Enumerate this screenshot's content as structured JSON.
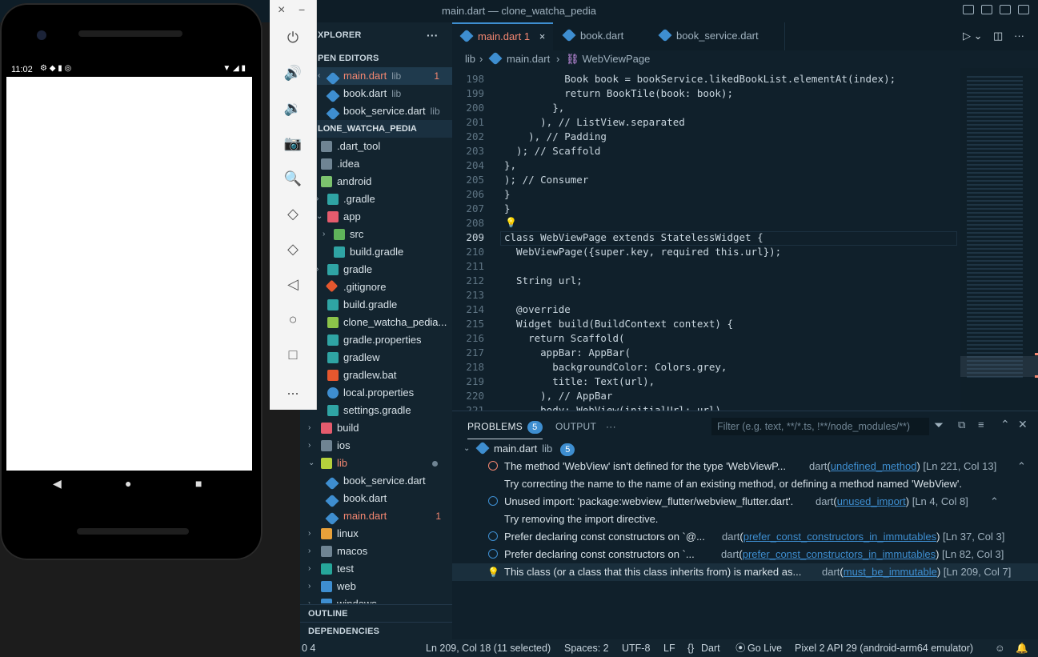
{
  "window": {
    "title": "main.dart — clone_watcha_pedia"
  },
  "emulator": {
    "close": "×",
    "minimize": "−",
    "status_time": "11:02",
    "tools": [
      "power-icon",
      "volume-up-icon",
      "volume-down-icon",
      "camera-icon",
      "zoom-icon",
      "rotate-left-icon",
      "rotate-right-icon",
      "back-icon",
      "home-icon",
      "overview-icon",
      "more-icon"
    ],
    "more_label": "..."
  },
  "explorer": {
    "title": "XPLORER",
    "more": "···",
    "open_editors": "PEN EDITORS",
    "open_files": [
      {
        "name": "main.dart",
        "sub": "lib",
        "count": "1",
        "error": true,
        "selected": true
      },
      {
        "name": "book.dart",
        "sub": "lib"
      },
      {
        "name": "book_service.dart",
        "sub": "lib"
      }
    ],
    "project": "LONE_WATCHA_PEDIA",
    "tree": [
      {
        "name": ".dart_tool"
      },
      {
        "name": ".idea"
      },
      {
        "name": "android"
      },
      {
        "name": ".gradle"
      },
      {
        "name": "app"
      },
      {
        "name": "src"
      },
      {
        "name": "build.gradle"
      },
      {
        "name": "gradle"
      },
      {
        "name": ".gitignore"
      },
      {
        "name": "build.gradle"
      },
      {
        "name": "clone_watcha_pedia..."
      },
      {
        "name": "gradle.properties"
      },
      {
        "name": "gradlew"
      },
      {
        "name": "gradlew.bat"
      },
      {
        "name": "local.properties"
      },
      {
        "name": "settings.gradle"
      },
      {
        "name": "build"
      },
      {
        "name": "ios"
      },
      {
        "name": "lib"
      },
      {
        "name": "book_service.dart"
      },
      {
        "name": "book.dart"
      },
      {
        "name": "main.dart",
        "count": "1"
      },
      {
        "name": "linux"
      },
      {
        "name": "macos"
      },
      {
        "name": "test"
      },
      {
        "name": "web"
      },
      {
        "name": "windows"
      }
    ],
    "outline": "OUTLINE",
    "dependencies": "DEPENDENCIES"
  },
  "tabs": [
    {
      "label": "main.dart",
      "count": "1",
      "close": "×"
    },
    {
      "label": "book.dart"
    },
    {
      "label": "book_service.dart"
    }
  ],
  "breadcrumb": {
    "folder": "lib",
    "file": "main.dart",
    "symbol": "WebViewPage"
  },
  "editor": {
    "lines": [
      {
        "n": "198",
        "code": "          Book book = bookService.likedBookList.elementAt(index);"
      },
      {
        "n": "199",
        "code": "          return BookTile(book: book);"
      },
      {
        "n": "200",
        "code": "        },"
      },
      {
        "n": "201",
        "code": "      ), // ListView.separated"
      },
      {
        "n": "202",
        "code": "    ), // Padding"
      },
      {
        "n": "203",
        "code": "  ); // Scaffold"
      },
      {
        "n": "204",
        "code": "},"
      },
      {
        "n": "205",
        "code": "); // Consumer"
      },
      {
        "n": "206",
        "code": "}"
      },
      {
        "n": "207",
        "code": "}"
      },
      {
        "n": "208",
        "code": ""
      },
      {
        "n": "209",
        "code": "class WebViewPage extends StatelessWidget {"
      },
      {
        "n": "210",
        "code": "  WebViewPage({super.key, required this.url});"
      },
      {
        "n": "211",
        "code": ""
      },
      {
        "n": "212",
        "code": "  String url;"
      },
      {
        "n": "213",
        "code": ""
      },
      {
        "n": "214",
        "code": "  @override"
      },
      {
        "n": "215",
        "code": "  Widget build(BuildContext context) {"
      },
      {
        "n": "216",
        "code": "    return Scaffold("
      },
      {
        "n": "217",
        "code": "      appBar: AppBar("
      },
      {
        "n": "218",
        "code": "        backgroundColor: Colors.grey,"
      },
      {
        "n": "219",
        "code": "        title: Text(url),"
      },
      {
        "n": "220",
        "code": "      ), // AppBar"
      },
      {
        "n": "221",
        "code": "      body: WebView(initialUrl: url)"
      }
    ]
  },
  "panel": {
    "tabs": {
      "problems": "PROBLEMS",
      "problems_count": "5",
      "output": "OUTPUT",
      "more": "···"
    },
    "filter_placeholder": "Filter (e.g. text, **/*.ts, !**/node_modules/**)",
    "file": {
      "name": "main.dart",
      "sub": "lib",
      "count": "5"
    },
    "problems": [
      {
        "severity": "error",
        "msg": "The method 'WebView' isn't defined for the type 'WebViewP...",
        "src": "dart",
        "code": "undefined_method",
        "pos": "[Ln 221, Col 13]",
        "hint": "Try correcting the name to the name of an existing method, or defining a method named 'WebView'."
      },
      {
        "severity": "info",
        "msg": "Unused import: 'package:webview_flutter/webview_flutter.dart'.",
        "src": "dart",
        "code": "unused_import",
        "pos": "[Ln 4, Col 8]",
        "hint": "Try removing the import directive."
      },
      {
        "severity": "info",
        "msg": "Prefer declaring const constructors on `@...",
        "src": "dart",
        "code": "prefer_const_constructors_in_immutables",
        "pos": "[Ln 37, Col 3]"
      },
      {
        "severity": "info",
        "msg": "Prefer declaring const constructors on `...",
        "src": "dart",
        "code": "prefer_const_constructors_in_immutables",
        "pos": "[Ln 82, Col 3]"
      },
      {
        "severity": "hint",
        "msg": "This class (or a class that this class inherits from) is marked as...",
        "src": "dart",
        "code": "must_be_immutable",
        "pos": "[Ln 209, Col 7]"
      }
    ]
  },
  "statusbar": {
    "problems": "0  4",
    "position": "Ln 209, Col 18 (11 selected)",
    "spaces": "Spaces: 2",
    "encoding": "UTF-8",
    "eol": "LF",
    "language": "Dart",
    "braces": "{}",
    "golive": "Go Live",
    "device": "Pixel 2 API 29 (android-arm64 emulator)"
  },
  "colors": {
    "accent": "#3e8ed0",
    "error": "#f48771",
    "bg": "#10202b"
  }
}
